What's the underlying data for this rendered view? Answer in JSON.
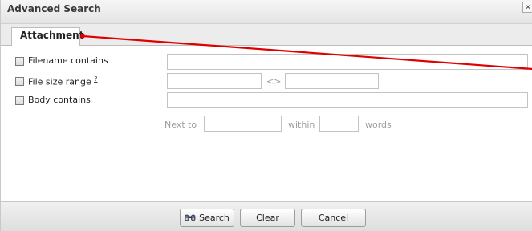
{
  "dialog": {
    "title": "Advanced Search",
    "close_glyph": "×"
  },
  "tabs": [
    {
      "label": "Attachment"
    }
  ],
  "form": {
    "filename": {
      "label": "Filename contains",
      "value": ""
    },
    "filesize": {
      "label": "File size range",
      "help": "?",
      "separator": "<>",
      "from_value": "",
      "to_value": ""
    },
    "body": {
      "label": "Body contains",
      "value": ""
    },
    "proximity": {
      "next_to": "Next to",
      "within": "within",
      "words": "words"
    }
  },
  "buttons": {
    "search": "Search",
    "clear": "Clear",
    "cancel": "Cancel"
  },
  "colors": {
    "annotation_arrow": "#e00000"
  },
  "icons": {
    "search_button_icon": "binoculars-icon"
  }
}
